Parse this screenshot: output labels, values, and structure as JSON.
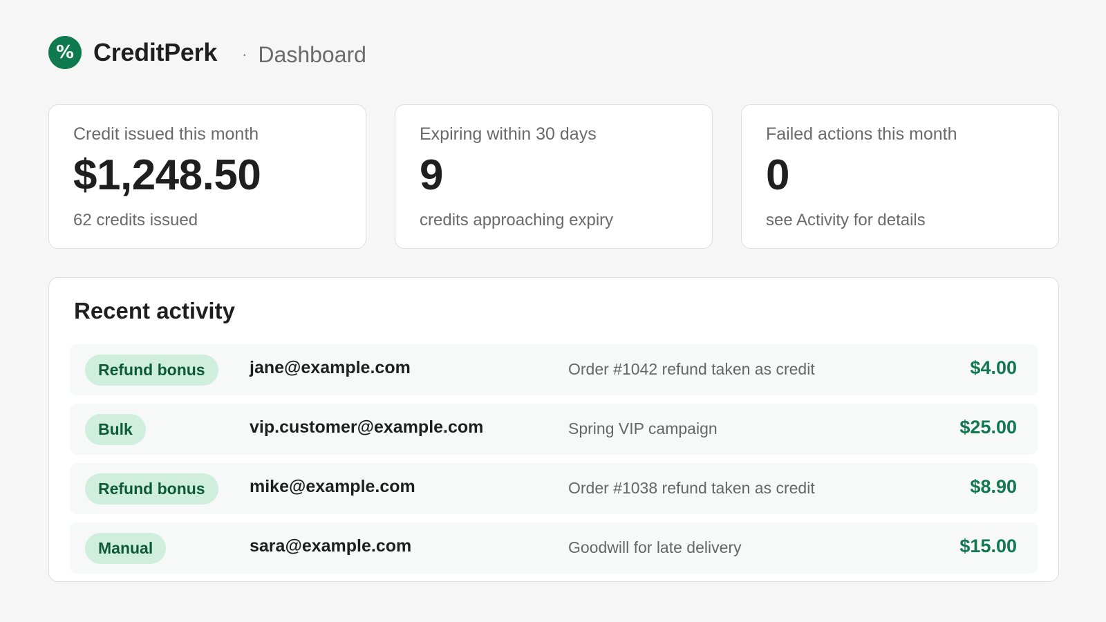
{
  "header": {
    "logo_icon": "percent-icon",
    "logo_glyph": "%",
    "brand": "CreditPerk",
    "separator": "·",
    "breadcrumb": "Dashboard"
  },
  "stats": [
    {
      "label": "Credit issued this month",
      "value": "$1,248.50",
      "sub": "62 credits issued"
    },
    {
      "label": "Expiring within 30 days",
      "value": "9",
      "sub": "credits approaching expiry"
    },
    {
      "label": "Failed actions this month",
      "value": "0",
      "sub": "see Activity for details"
    }
  ],
  "activity": {
    "title": "Recent activity",
    "rows": [
      {
        "type": "Refund bonus",
        "email": "jane@example.com",
        "description": "Order #1042 refund taken as credit",
        "amount": "$4.00"
      },
      {
        "type": "Bulk",
        "email": "vip.customer@example.com",
        "description": "Spring VIP campaign",
        "amount": "$25.00"
      },
      {
        "type": "Refund bonus",
        "email": "mike@example.com",
        "description": "Order #1038 refund taken as credit",
        "amount": "$8.90"
      },
      {
        "type": "Manual",
        "email": "sara@example.com",
        "description": "Goodwill for late delivery",
        "amount": "$15.00"
      }
    ]
  },
  "colors": {
    "brand": "#0f7a4f",
    "badge_bg": "#cfeede",
    "badge_text": "#0d5a3a",
    "amount": "#12784f",
    "background": "#f6f6f6"
  }
}
